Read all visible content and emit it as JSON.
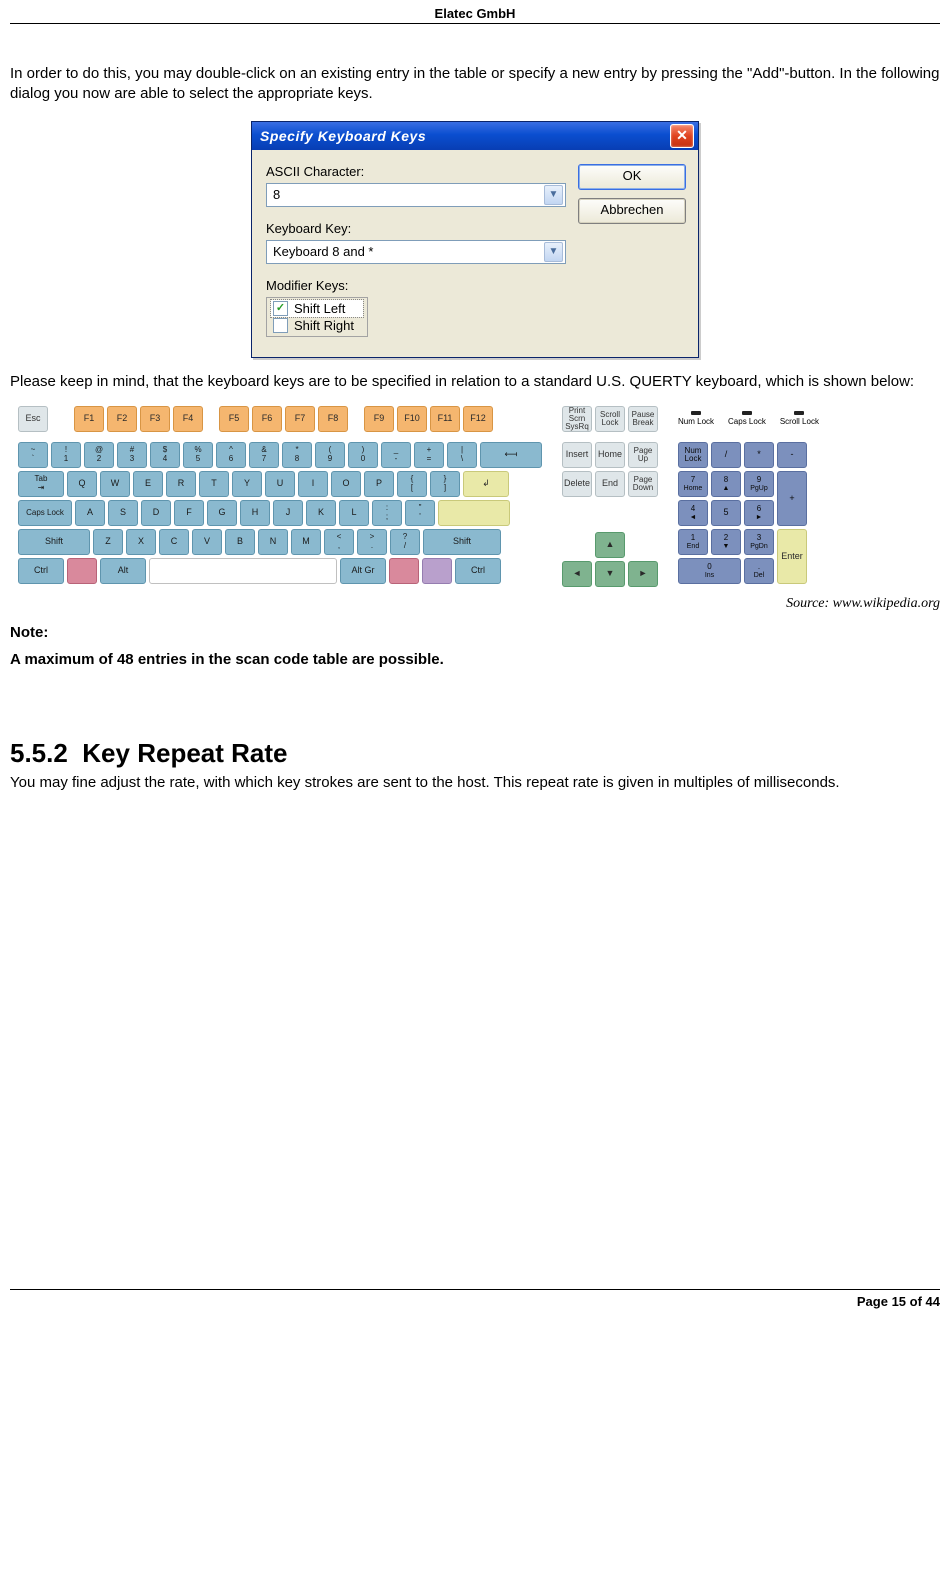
{
  "header": {
    "company": "Elatec GmbH"
  },
  "intro": "In order to do this, you may double-click on an existing entry in the table or specify a new entry by pressing the \"Add\"-button. In the following dialog you now are able to select the appropriate keys.",
  "dialog": {
    "title": "Specify Keyboard Keys",
    "ascii_label": "ASCII Character:",
    "ascii_value": "8",
    "key_label": "Keyboard Key:",
    "key_value": "Keyboard 8 and *",
    "mod_label": "Modifier Keys:",
    "mod_shift_left": "Shift Left",
    "mod_shift_right": "Shift Right",
    "btn_ok": "OK",
    "btn_cancel": "Abbrechen"
  },
  "mid": "Please keep in mind, that the keyboard keys are to be specified in relation to a standard U.S. QUERTY keyboard, which is shown below:",
  "keyboard": {
    "esc": "Esc",
    "frow": [
      "F1",
      "F2",
      "F3",
      "F4",
      "F5",
      "F6",
      "F7",
      "F8",
      "F9",
      "F10",
      "F11",
      "F12"
    ],
    "sys": {
      "prtsc": "Print\nScrn\nSysRq",
      "slock": "Scroll\nLock",
      "pause": "Pause\nBreak"
    },
    "leds": {
      "num": "Num\nLock",
      "caps": "Caps\nLock",
      "scroll": "Scroll\nLock"
    },
    "row1": [
      [
        "~",
        "`"
      ],
      [
        "!",
        "1"
      ],
      [
        "@",
        "2"
      ],
      [
        "#",
        "3"
      ],
      [
        "$",
        "4"
      ],
      [
        "%",
        "5"
      ],
      [
        "^",
        "6"
      ],
      [
        "&",
        "7"
      ],
      [
        "*",
        "8"
      ],
      [
        "(",
        "9"
      ],
      [
        ")",
        "0"
      ],
      [
        "_",
        "-"
      ],
      [
        "+",
        "="
      ],
      [
        "|",
        "\\"
      ]
    ],
    "tab": "Tab",
    "row2": [
      "Q",
      "W",
      "E",
      "R",
      "T",
      "Y",
      "U",
      "I",
      "O",
      "P"
    ],
    "row2b": [
      [
        "{",
        "["
      ],
      [
        "}",
        "]"
      ]
    ],
    "caps": "Caps\nLock",
    "row3": [
      "A",
      "S",
      "D",
      "F",
      "G",
      "H",
      "J",
      "K",
      "L"
    ],
    "row3b": [
      [
        ":",
        ";"
      ],
      [
        "\"",
        "'"
      ]
    ],
    "shift": "Shift",
    "row4": [
      "Z",
      "X",
      "C",
      "V",
      "B",
      "N",
      "M"
    ],
    "row4b": [
      [
        "<",
        ","
      ],
      [
        ">",
        "."
      ],
      [
        "?",
        "/"
      ]
    ],
    "ctrl": "Ctrl",
    "alt": "Alt",
    "altgr": "Alt Gr",
    "nav": {
      "ins": "Insert",
      "home": "Home",
      "pgup": "Page\nUp",
      "del": "Delete",
      "end": "End",
      "pgdn": "Page\nDown"
    },
    "arrows": {
      "up": "▲",
      "left": "◄",
      "down": "▼",
      "right": "►"
    },
    "numpad": {
      "nlock": "Num\nLock",
      "div": "/",
      "mul": "*",
      "sub": "-",
      "k7": [
        "7",
        "Home"
      ],
      "k8": [
        "8",
        "▲"
      ],
      "k9": [
        "9",
        "PgUp"
      ],
      "add": "+",
      "k4": [
        "4",
        "◄"
      ],
      "k5": "5",
      "k6": [
        "6",
        "►"
      ],
      "k1": [
        "1",
        "End"
      ],
      "k2": [
        "2",
        "▼"
      ],
      "k3": [
        "3",
        "PgDn"
      ],
      "enter": "Enter",
      "k0": [
        "0",
        "Ins"
      ],
      "kdot": [
        ".",
        "Del"
      ]
    }
  },
  "source": "Source: www.wikipedia.org",
  "note_label": "Note:",
  "note_text": "A maximum of 48 entries in the scan code table are possible.",
  "section": {
    "num": "5.5.2",
    "title": "Key Repeat Rate"
  },
  "section_body": "You may fine adjust the rate, with which key strokes are sent to the host. This repeat rate is given in multiples of milliseconds.",
  "footer": "Page 15 of 44"
}
